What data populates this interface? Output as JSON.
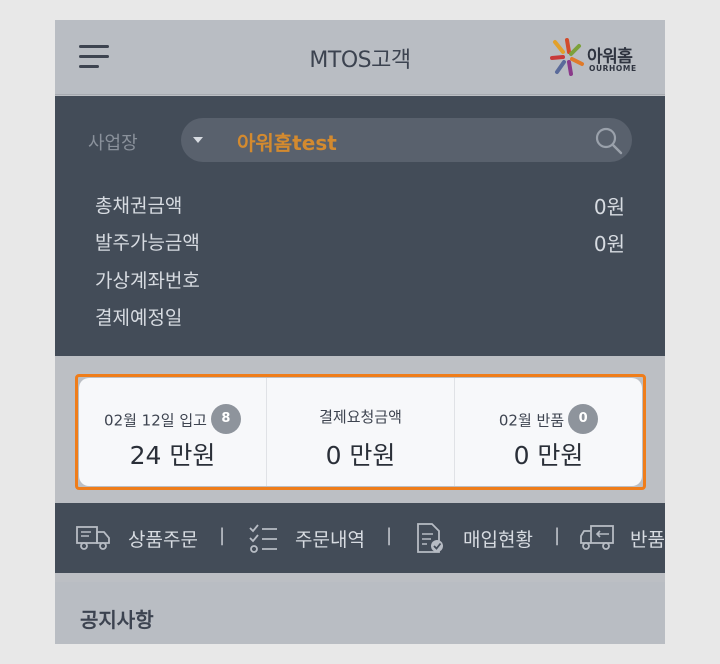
{
  "header": {
    "title": "MTOS고객",
    "logo_text": "아워홈",
    "logo_subtext": "OURHOME"
  },
  "info": {
    "business_label": "사업장",
    "business_value": "아워홈test",
    "rows": [
      {
        "label": "총채권금액",
        "value": "0원"
      },
      {
        "label": "발주가능금액",
        "value": "0원"
      },
      {
        "label": "가상계좌번호",
        "value": ""
      },
      {
        "label": "결제예정일",
        "value": ""
      }
    ]
  },
  "summary": [
    {
      "label": "02월 12일 입고",
      "badge": "8",
      "amount": "24 만원"
    },
    {
      "label": "결제요청금액",
      "badge": "",
      "amount": "0 만원"
    },
    {
      "label": "02월 반품",
      "badge": "0",
      "amount": "0 만원"
    }
  ],
  "quick_menu": [
    {
      "label": "상품주문",
      "icon": "truck-icon"
    },
    {
      "label": "주문내역",
      "icon": "checklist-icon"
    },
    {
      "label": "매입현황",
      "icon": "document-check-icon"
    },
    {
      "label": "반품",
      "icon": "return-truck-icon"
    }
  ],
  "quick_menu_separator": "|",
  "notice": {
    "title": "공지사항"
  },
  "colors": {
    "accent": "#d38a2f",
    "highlight_border": "#ef7d1a",
    "panel_dark": "#434c58",
    "header_bg": "#b9bdc3"
  }
}
